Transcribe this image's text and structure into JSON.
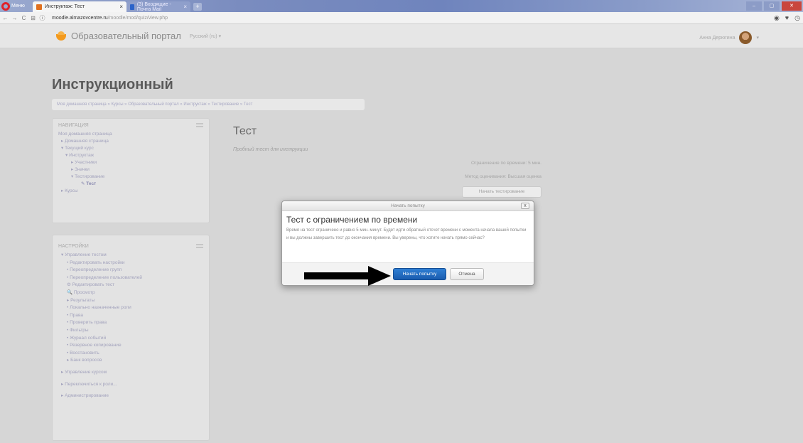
{
  "browser": {
    "menu_label": "Меню",
    "tabs": [
      {
        "title": "Инструктаж: Тест",
        "active": true
      },
      {
        "title": "(3) Входящие - Почта Mail",
        "active": false
      }
    ],
    "new_tab": "+",
    "url_host": "moodle.almazovcentre.ru",
    "url_path": "/moodle/mod/quiz/view.php"
  },
  "header": {
    "site_name": "Образовательный портал",
    "language": "Русский (ru) ▾",
    "user_name": "Анна Дерюгина",
    "user_caret": "▾"
  },
  "page": {
    "course_title": "Инструкционный",
    "breadcrumb": "Моя домашняя страница  »  Курсы  »  Образовательный портал  »  Инструктаж  »  Тестирование  »  Тест"
  },
  "navigation_block": {
    "title": "НАВИГАЦИЯ",
    "items": [
      "Моя домашняя страница",
      "▸ Домашняя страница",
      "▾ Текущий курс",
      "▾ Инструктаж",
      "▸ Участники",
      "▸ Значки",
      "▾ Тестирование",
      "Тест",
      "▸ Курсы"
    ]
  },
  "settings_block": {
    "title": "НАСТРОЙКИ",
    "items": [
      "▾ Управление тестом",
      "• Редактировать настройки",
      "• Переопределение групп",
      "• Переопределение пользователей",
      "⚙ Редактировать тест",
      "🔍 Просмотр",
      "▸ Результаты",
      "• Локально назначенные роли",
      "• Права",
      "• Проверить права",
      "• Фильтры",
      "• Журнал событий",
      "• Резервное копирование",
      "• Восстановить",
      "▸ Банк вопросов",
      "▸ Управление курсом",
      "▸ Переключиться к роли...",
      "▸ Администрирование"
    ]
  },
  "quiz": {
    "title": "Тест",
    "intro": "Пробный тест для инструкции",
    "time_limit": "Ограничение по времени: 5 мин.",
    "grading_method": "Метод оценивания: Высшая оценка",
    "start_button": "Начать тестирование"
  },
  "modal": {
    "header": "Начать попытку",
    "close": "x",
    "title": "Тест с ограничением по времени",
    "text": "Время на тест ограничено и равно 5 мин. минут. Будет идти обратный отсчет времени с момента начала вашей попытки и вы должны завершить тест до окончания времени. Вы уверены, что хотите начать прямо сейчас?",
    "primary_button": "Начать попытку",
    "cancel_button": "Отмена"
  }
}
